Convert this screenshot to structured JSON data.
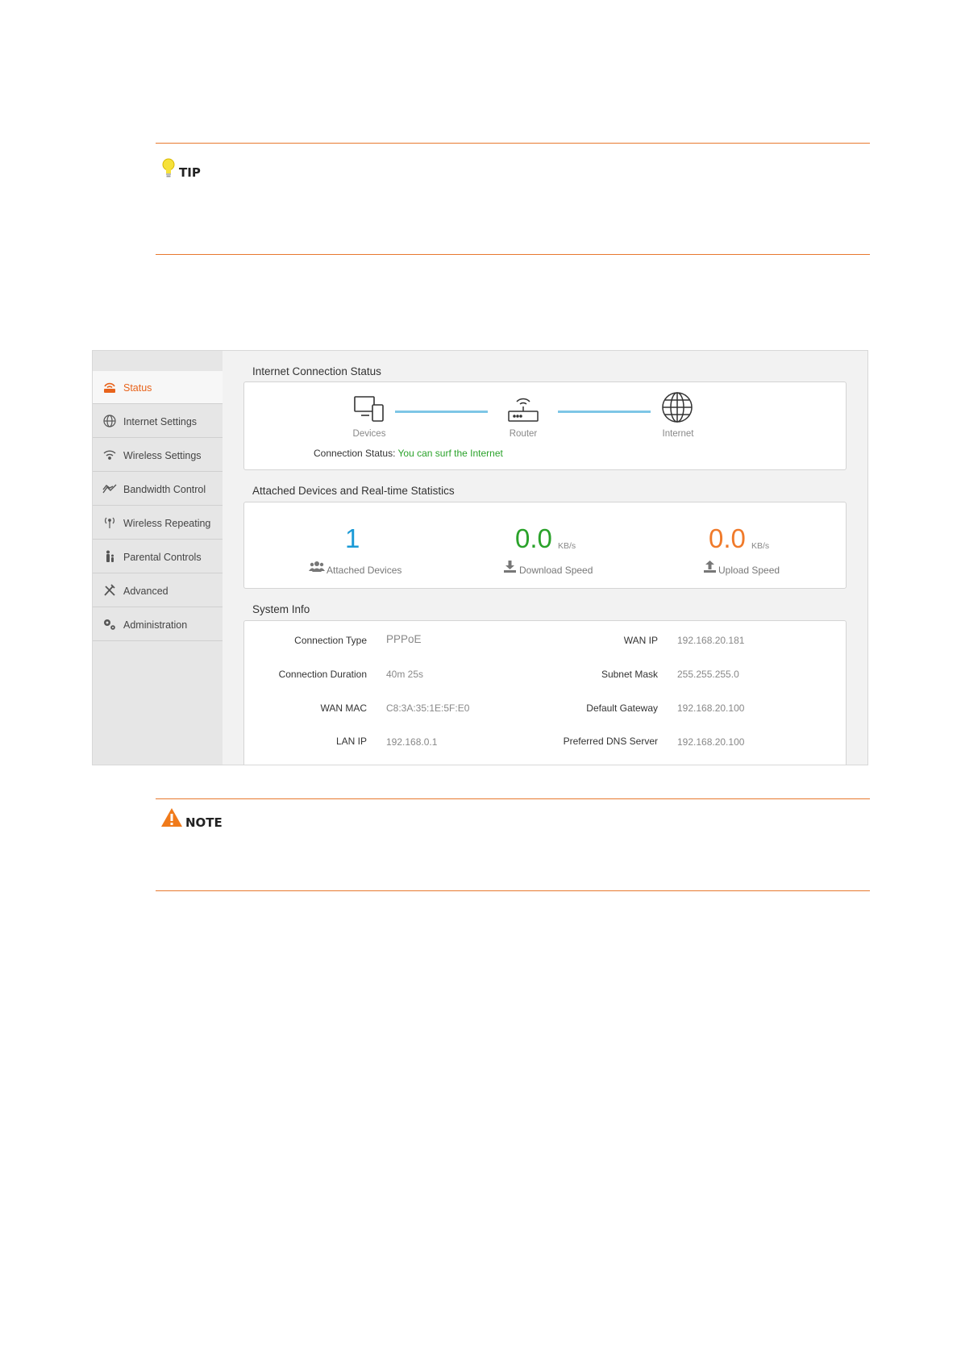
{
  "tip": {
    "label": "TIP"
  },
  "note": {
    "label": "NOTE"
  },
  "sidebar": {
    "items": [
      {
        "label": "Status",
        "icon": "router-icon",
        "active": true
      },
      {
        "label": "Internet Settings",
        "icon": "globe-icon"
      },
      {
        "label": "Wireless Settings",
        "icon": "wifi-icon"
      },
      {
        "label": "Bandwidth Control",
        "icon": "bandwidth-icon"
      },
      {
        "label": "Wireless Repeating",
        "icon": "antenna-icon"
      },
      {
        "label": "Parental Controls",
        "icon": "parent-child-icon"
      },
      {
        "label": "Advanced",
        "icon": "tools-icon"
      },
      {
        "label": "Administration",
        "icon": "gears-icon"
      }
    ]
  },
  "connection": {
    "title": "Internet Connection Status",
    "devices_label": "Devices",
    "router_label": "Router",
    "internet_label": "Internet",
    "status_label": "Connection Status:",
    "status_value": "You can surf the Internet"
  },
  "stats": {
    "title": "Attached Devices and Real-time Statistics",
    "attached_value": "1",
    "attached_label": "Attached Devices",
    "download_value": "0.0",
    "download_unit": "KB/s",
    "download_label": "Download Speed",
    "upload_value": "0.0",
    "upload_unit": "KB/s",
    "upload_label": "Upload Speed"
  },
  "system": {
    "title": "System Info",
    "left": [
      {
        "label": "Connection Type",
        "value": "PPPoE"
      },
      {
        "label": "Connection Duration",
        "value": "40m 25s"
      },
      {
        "label": "WAN MAC",
        "value": "C8:3A:35:1E:5F:E0"
      },
      {
        "label": "LAN IP",
        "value": "192.168.0.1"
      }
    ],
    "right": [
      {
        "label": "WAN IP",
        "value": "192.168.20.181"
      },
      {
        "label": "Subnet Mask",
        "value": "255.255.255.0"
      },
      {
        "label": "Default Gateway",
        "value": "192.168.20.100"
      },
      {
        "label": "Preferred DNS Server",
        "value": "192.168.20.100"
      }
    ]
  },
  "colors": {
    "accent": "#e8631b",
    "rule": "#e8792e",
    "blue": "#1a9ad6",
    "green": "#2aa22a",
    "orange": "#f07a2a",
    "link_line": "#7ec6e6"
  }
}
